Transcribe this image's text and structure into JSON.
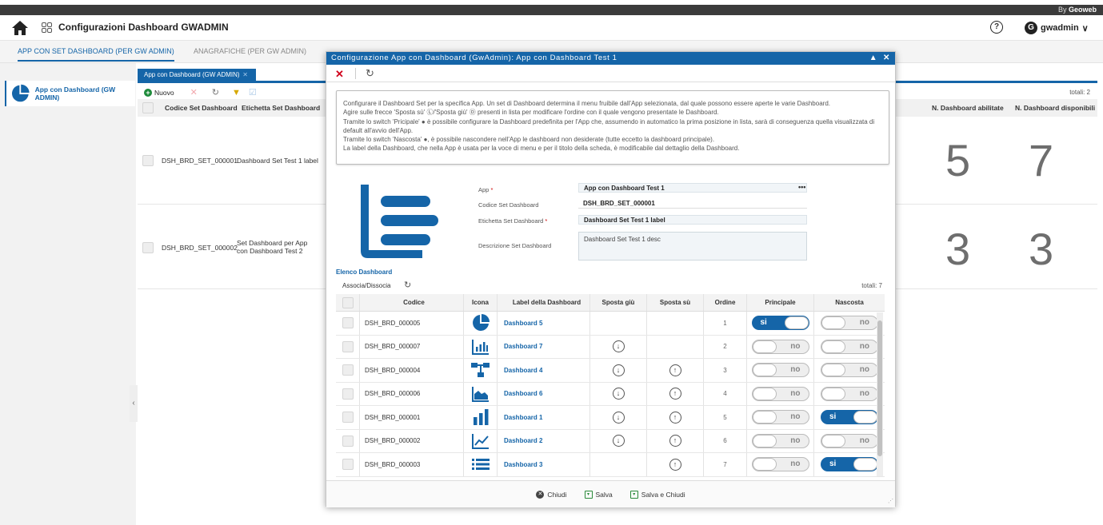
{
  "brand": {
    "by": "By",
    "name": "Geoweb"
  },
  "header": {
    "title": "Configurazioni Dashboard GWADMIN",
    "help": "?",
    "user_initial": "G",
    "user": "gwadmin",
    "user_caret": "∨"
  },
  "tabs": [
    "APP CON SET DASHBOARD (PER GW ADMIN)",
    "ANAGRAFICHE (PER GW ADMIN)"
  ],
  "sidebar": {
    "item": "App con Dashboard (GW ADMIN)",
    "collapse": "‹"
  },
  "subtab": {
    "label": "App con Dashboard (GW ADMIN)",
    "close": "✕"
  },
  "toolbar": {
    "new": "Nuovo",
    "totali": "totali: 2"
  },
  "bg_table": {
    "headers": [
      "Codice Set Dashboard",
      "Etichetta Set Dashboard",
      "N. Dashboard abilitate",
      "N. Dashboard disponibili"
    ],
    "rows": [
      {
        "code": "DSH_BRD_SET_000001",
        "label": "Dashboard Set Test 1 label",
        "abilitate": "5",
        "disponibili": "7"
      },
      {
        "code": "DSH_BRD_SET_000002",
        "label": "Set Dashboard per App con Dashboard Test 2",
        "abilitate": "3",
        "disponibili": "3"
      }
    ]
  },
  "modal": {
    "title": "Configurazione App con Dashboard (GwAdmin): App con Dashboard Test 1",
    "info": [
      "Configurare il Dashboard Set per la specifica App. Un set di Dashboard determina il menu fruibile dall'App selezionata, dal quale possono essere aperte le varie Dashboard.",
      "Agire sulle frecce 'Sposta sù' Ⓛ/'Sposta giù' Ⓓ presenti in lista per modificare l'ordine con il quale vengono presentate le Dashboard.",
      "Tramite lo switch 'Pricipale' ● è possibile configurare la Dashboard predefinita per l'App che, assumendo in automatico la prima posizione in lista, sarà di conseguenza quella visualizzata di default all'avvio dell'App.",
      "Tramite lo switch 'Nascosta' ●, è possibile nascondere nell'App le dashboard non desiderate (tutte eccetto la dashboard principale).",
      "La label della Dashboard, che nella App è usata per la voce di menu e per il titolo della scheda, è modificabile dal dettaglio della Dashboard."
    ],
    "form": {
      "app_label": "App",
      "app_value": "App con Dashboard Test 1",
      "code_label": "Codice Set Dashboard",
      "code_value": "DSH_BRD_SET_000001",
      "etichetta_label": "Etichetta Set Dashboard",
      "etichetta_value": "Dashboard Set Test 1 label",
      "desc_label": "Descrizione Set Dashboard",
      "desc_value": "Dashboard Set Test 1 desc",
      "required_mark": "*",
      "more": "•••"
    },
    "list": {
      "title": "Elenco Dashboard",
      "associa": "Associa/Dissocia",
      "totali": "totali: 7",
      "headers": [
        "Codice",
        "Icona",
        "Label della Dashboard",
        "Sposta giù",
        "Sposta sù",
        "Ordine",
        "Principale",
        "Nascosta"
      ],
      "switch_on": "si",
      "switch_off": "no",
      "rows": [
        {
          "code": "DSH_BRD_000005",
          "icon": "pie-icon",
          "label": "Dashboard 5",
          "down": false,
          "up": false,
          "order": "1",
          "principale": true,
          "nascosta": false
        },
        {
          "code": "DSH_BRD_000007",
          "icon": "bar-chart-box-icon",
          "label": "Dashboard 7",
          "down": true,
          "up": false,
          "order": "2",
          "principale": false,
          "nascosta": false
        },
        {
          "code": "DSH_BRD_000004",
          "icon": "flow-icon",
          "label": "Dashboard 4",
          "down": true,
          "up": true,
          "order": "3",
          "principale": false,
          "nascosta": false
        },
        {
          "code": "DSH_BRD_000006",
          "icon": "area-chart-icon",
          "label": "Dashboard 6",
          "down": true,
          "up": true,
          "order": "4",
          "principale": false,
          "nascosta": false
        },
        {
          "code": "DSH_BRD_000001",
          "icon": "bars-icon",
          "label": "Dashboard 1",
          "down": true,
          "up": true,
          "order": "5",
          "principale": false,
          "nascosta": true
        },
        {
          "code": "DSH_BRD_000002",
          "icon": "line-chart-icon",
          "label": "Dashboard 2",
          "down": true,
          "up": true,
          "order": "6",
          "principale": false,
          "nascosta": false
        },
        {
          "code": "DSH_BRD_000003",
          "icon": "list-icon",
          "label": "Dashboard 3",
          "down": false,
          "up": true,
          "order": "7",
          "principale": false,
          "nascosta": true
        }
      ]
    },
    "footer": {
      "close": "Chiudi",
      "save": "Salva",
      "save_close": "Salva e Chiudi"
    }
  },
  "colors": {
    "accent": "#1565a8",
    "close": "#d0021b",
    "new": "#1d8a3a"
  }
}
